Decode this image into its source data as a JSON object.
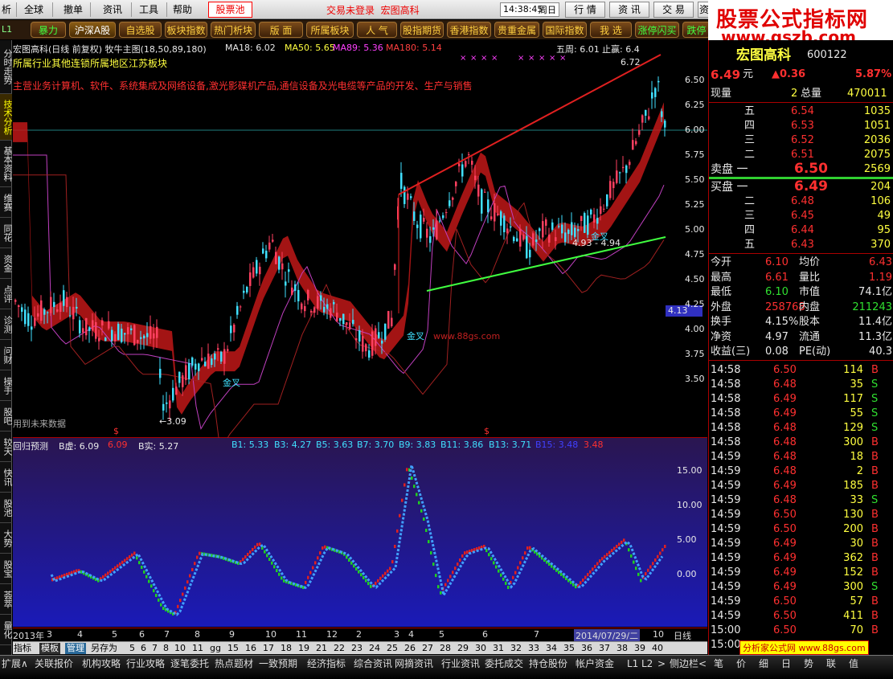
{
  "menu": {
    "items": [
      "析",
      "全球",
      "撤单",
      "资讯",
      "工具",
      "帮助"
    ],
    "pool_label": "股票池",
    "login_status": "交易未登录",
    "login_name": "宏图高科",
    "clock": "14:38:45",
    "weekday": "周日",
    "buttons": [
      "行 情",
      "资 讯",
      "交 易",
      "资"
    ]
  },
  "tabs": {
    "l1": "L1",
    "items": [
      "暴力",
      "沪深A股",
      "自选股",
      "板块指数",
      "热门析块",
      "版 面",
      "所属板块",
      "人 气",
      "股指期货",
      "香港指数",
      "贵重金属",
      "国际指数",
      "我 选",
      "涨停闪买",
      "跌停"
    ]
  },
  "leftnav": [
    "分时走势",
    "技术分析",
    "基本资料",
    "维赛",
    "同花",
    "资金",
    "点评",
    "诊测",
    "问财",
    "操手",
    "股吧",
    "较天",
    "快讯",
    "股池",
    "大势",
    "股宝",
    "荟萃",
    "量化"
  ],
  "chart": {
    "title": "宏图高科(日线 前复权) 牧牛主图(18,50,89,180)",
    "ma18": "MA18: 6.02",
    "ma50": "MA50: 5.65",
    "ma89": "MA89: 5.36",
    "ma180": "MA180: 5.14",
    "wuzhou": "五周: 6.01",
    "zhiying": "止赢: 6.4",
    "industry": "所属行业其他连锁所属地区江苏板块",
    "business": "主营业务计算机、软件、系统集成及网络设备,激光影碟机产品,通信设备及光电缆等产品的开发、生产与销售",
    "high_mark": "6.72",
    "low_mark": "←3.09",
    "range_mark": "4.93 - 4.94",
    "future_note": "用到未来数据",
    "cross1": "金叉",
    "cross2": "金叉",
    "cross3": "金叉",
    "site": "www.88gs.com",
    "cur_price": "4.13",
    "yaxis": [
      "6.50",
      "6.25",
      "6.00",
      "5.75",
      "5.50",
      "5.25",
      "5.00",
      "4.75",
      "4.50",
      "4.25",
      "4.00",
      "3.75",
      "3.50"
    ],
    "dollar1": "$",
    "dollar2": "$"
  },
  "indicator": {
    "name": "回归预测",
    "bxu": "B虚: 6.09",
    "bxu2": "6.09",
    "bshi": "B实: 5.27",
    "b1": "B1: 5.33",
    "b3": "B3: 4.27",
    "b5": "B5: 3.63",
    "b7": "B7: 3.70",
    "b9": "B9: 3.83",
    "b11": "B11: 3.86",
    "b13": "B13: 3.71",
    "b15": "B15: 3.48",
    "b15b": "3.48",
    "yaxis": [
      "15.00",
      "10.00",
      "5.00",
      "0.00"
    ]
  },
  "dateaxis": {
    "labels": [
      "2013年",
      "3",
      "4",
      "5",
      "6",
      "7",
      "8",
      "9",
      "10",
      "11",
      "12",
      "2",
      "3",
      "4",
      "5",
      "6",
      "7",
      "10"
    ],
    "selected": "2014/07/29/二",
    "period": "日线"
  },
  "tplbar": [
    "指标",
    "模板",
    "管理",
    "另存为",
    "5",
    "6",
    "7",
    "8",
    "10",
    "11",
    "gg",
    "15",
    "16",
    "17",
    "18",
    "19",
    "21",
    "22",
    "23",
    "24",
    "25",
    "26",
    "27",
    "28",
    "29",
    "30",
    "31",
    "32",
    "33",
    "34",
    "35",
    "36",
    "37",
    "38",
    "39",
    "40"
  ],
  "bottombar": [
    "扩展∧",
    "关联报价",
    "机构攻略",
    "行业攻略",
    "逐笔委托",
    "热点题材",
    "一致预期",
    "经济指标",
    "综合资讯",
    "网摘资讯",
    "行业资讯",
    "委托成交",
    "持仓股份",
    "帐户资金",
    "L1",
    "L2",
    ">",
    "侧边栏<",
    "笔",
    "价",
    "细",
    "日",
    "势",
    "联",
    "值"
  ],
  "watermark": {
    "line1": "股票公式指标网",
    "line2": "www.gszb.com",
    "bottom": "分析家公式网 www.88gs.com"
  },
  "quote": {
    "name": "宏图高科",
    "code": "600122",
    "price": "6.49",
    "unit": "元",
    "change": "▲0.36",
    "pct": "5.87%",
    "xianliang_label": "现量",
    "xianliang": "2",
    "zongliang_label": "总量",
    "zongliang": "470011",
    "asks": [
      {
        "label": "五",
        "price": "6.54",
        "vol": "1035"
      },
      {
        "label": "四",
        "price": "6.53",
        "vol": "1051"
      },
      {
        "label": "三",
        "price": "6.52",
        "vol": "2036"
      },
      {
        "label": "二",
        "price": "6.51",
        "vol": "2075"
      },
      {
        "label": "卖盘 一",
        "price": "6.50",
        "vol": "2569"
      }
    ],
    "bids": [
      {
        "label": "买盘 一",
        "price": "6.49",
        "vol": "204"
      },
      {
        "label": "二",
        "price": "6.48",
        "vol": "106"
      },
      {
        "label": "三",
        "price": "6.45",
        "vol": "49"
      },
      {
        "label": "四",
        "price": "6.44",
        "vol": "95"
      },
      {
        "label": "五",
        "price": "6.43",
        "vol": "370"
      }
    ],
    "stats": [
      {
        "l1": "今开",
        "v1": "6.10",
        "l2": "均价",
        "v2": "6.43"
      },
      {
        "l1": "最高",
        "v1": "6.61",
        "l2": "量比",
        "v2": "1.19"
      },
      {
        "l1": "最低",
        "v1": "6.10",
        "l2": "市值",
        "v2": "74.1亿"
      },
      {
        "l1": "外盘",
        "v1": "258768",
        "l2": "内盘",
        "v2": "211243"
      },
      {
        "l1": "换手",
        "v1": "4.15%",
        "l2": "股本",
        "v2": "11.4亿"
      },
      {
        "l1": "净资",
        "v1": "4.97",
        "l2": "流通",
        "v2": "11.3亿"
      },
      {
        "l1": "收益(三)",
        "v1": "0.08",
        "l2": "PE(动)",
        "v2": "40.3"
      }
    ],
    "ticks": [
      {
        "t": "14:58",
        "p": "6.50",
        "v": "114",
        "d": "B"
      },
      {
        "t": "14:58",
        "p": "6.48",
        "v": "35",
        "d": "S"
      },
      {
        "t": "14:58",
        "p": "6.49",
        "v": "117",
        "d": "S"
      },
      {
        "t": "14:58",
        "p": "6.49",
        "v": "55",
        "d": "S"
      },
      {
        "t": "14:58",
        "p": "6.48",
        "v": "129",
        "d": "S"
      },
      {
        "t": "14:58",
        "p": "6.48",
        "v": "300",
        "d": "B"
      },
      {
        "t": "14:59",
        "p": "6.48",
        "v": "18",
        "d": "B"
      },
      {
        "t": "14:59",
        "p": "6.48",
        "v": "2",
        "d": "B"
      },
      {
        "t": "14:59",
        "p": "6.49",
        "v": "185",
        "d": "B"
      },
      {
        "t": "14:59",
        "p": "6.48",
        "v": "33",
        "d": "S"
      },
      {
        "t": "14:59",
        "p": "6.50",
        "v": "130",
        "d": "B"
      },
      {
        "t": "14:59",
        "p": "6.50",
        "v": "200",
        "d": "B"
      },
      {
        "t": "14:59",
        "p": "6.49",
        "v": "30",
        "d": "B"
      },
      {
        "t": "14:59",
        "p": "6.49",
        "v": "362",
        "d": "B"
      },
      {
        "t": "14:59",
        "p": "6.49",
        "v": "152",
        "d": "B"
      },
      {
        "t": "14:59",
        "p": "6.49",
        "v": "300",
        "d": "S"
      },
      {
        "t": "14:59",
        "p": "6.50",
        "v": "57",
        "d": "B"
      },
      {
        "t": "14:59",
        "p": "6.50",
        "v": "411",
        "d": "B"
      },
      {
        "t": "15:00",
        "p": "6.50",
        "v": "70",
        "d": "B"
      },
      {
        "t": "15:00",
        "p": "",
        "v": "",
        "d": ""
      }
    ]
  }
}
